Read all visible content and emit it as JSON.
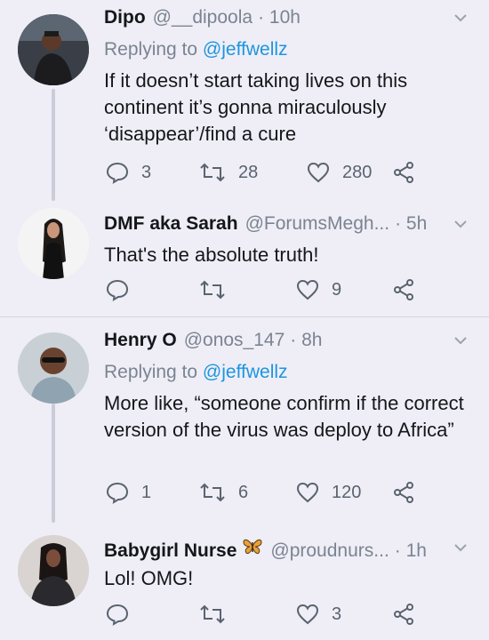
{
  "tweets": [
    {
      "name": "Dipo",
      "handle": "@__dipoola",
      "time": "· 10h",
      "replying_label": "Replying to",
      "replying_to": "@jeffwellz",
      "text": "If it doesn’t start taking lives on this continent it’s gonna miraculously ‘disappear’/find a cure",
      "replies": "3",
      "retweets": "28",
      "likes": "280"
    },
    {
      "name": "DMF aka Sarah",
      "handle": "@ForumsMegh...",
      "time": "· 5h",
      "text": "That's the absolute truth!",
      "replies": "",
      "retweets": "",
      "likes": "9"
    },
    {
      "name": "Henry O",
      "handle": "@onos_147",
      "time": "· 8h",
      "replying_label": "Replying to",
      "replying_to": "@jeffwellz",
      "text": "More like, “someone confirm if the correct version of the virus was deploy to Africa”",
      "replies": "1",
      "retweets": "6",
      "likes": "120"
    },
    {
      "name": "Babygirl Nurse",
      "emoji": "butterfly-emoji",
      "handle": "@proudnurs...",
      "time": "· 1h",
      "text": "Lol! OMG!",
      "replies": "",
      "retweets": "",
      "likes": "3"
    }
  ],
  "colors": {
    "background": "#efeef6",
    "link": "#1d95e0",
    "muted": "#7a8491",
    "icon": "#59636f",
    "divider": "#d4d5de"
  }
}
